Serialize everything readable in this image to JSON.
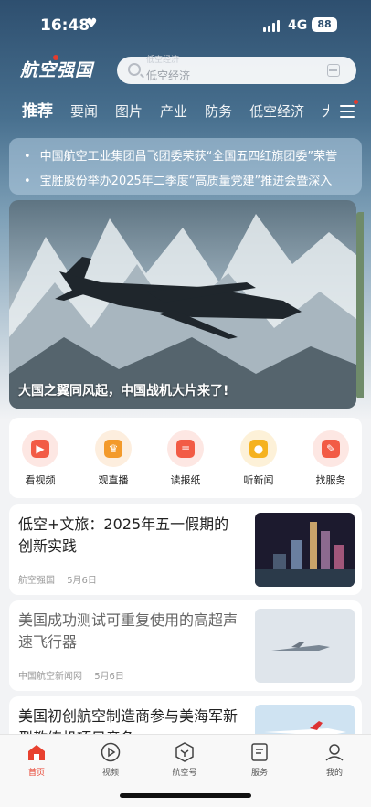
{
  "status_bar": {
    "time": "16:48",
    "heart": "♥",
    "network": "4G",
    "battery": "88"
  },
  "header": {
    "logo_text": "航空强国",
    "search": {
      "placeholder": "低空经济",
      "hint": "低空经济"
    }
  },
  "tabs": [
    {
      "label": "推荐",
      "active": true
    },
    {
      "label": "要闻"
    },
    {
      "label": "图片"
    },
    {
      "label": "产业"
    },
    {
      "label": "防务"
    },
    {
      "label": "低空经济"
    },
    {
      "label": "大"
    }
  ],
  "ticker": [
    "中国航空工业集团昌飞团委荣获“全国五四红旗团委”荣誉",
    "宝胜股份举办2025年二季度“高质量党建”推进会暨深入"
  ],
  "banner": {
    "title": "大国之翼同风起，中国战机大片来了!"
  },
  "quick_actions": [
    {
      "label": "看视频",
      "icon": "video-icon",
      "glyph": "▶"
    },
    {
      "label": "观直播",
      "icon": "trophy-icon",
      "glyph": "♛"
    },
    {
      "label": "读报纸",
      "icon": "newspaper-icon",
      "glyph": "≡"
    },
    {
      "label": "听新闻",
      "icon": "microphone-icon",
      "glyph": "●"
    },
    {
      "label": "找服务",
      "icon": "service-icon",
      "glyph": "✎"
    }
  ],
  "news": [
    {
      "title": "低空+文旅：2025年五一假期的创新实践",
      "source": "航空强国",
      "date": "5月6日"
    },
    {
      "title": "美国成功测试可重复使用的高超声速飞行器",
      "source": "中国航空新闻网",
      "date": "5月6日"
    },
    {
      "title": "美国初创航空制造商参与美海军新型教练机项目竞争",
      "source": "",
      "date": ""
    }
  ],
  "tabbar": [
    {
      "label": "首页",
      "icon": "home-icon",
      "active": true
    },
    {
      "label": "视频",
      "icon": "play-circle-icon"
    },
    {
      "label": "航空号",
      "icon": "aviation-badge-icon"
    },
    {
      "label": "服务",
      "icon": "document-icon"
    },
    {
      "label": "我的",
      "icon": "user-icon"
    }
  ],
  "colors": {
    "accent": "#e8412f",
    "header": "#2e4f6f"
  }
}
